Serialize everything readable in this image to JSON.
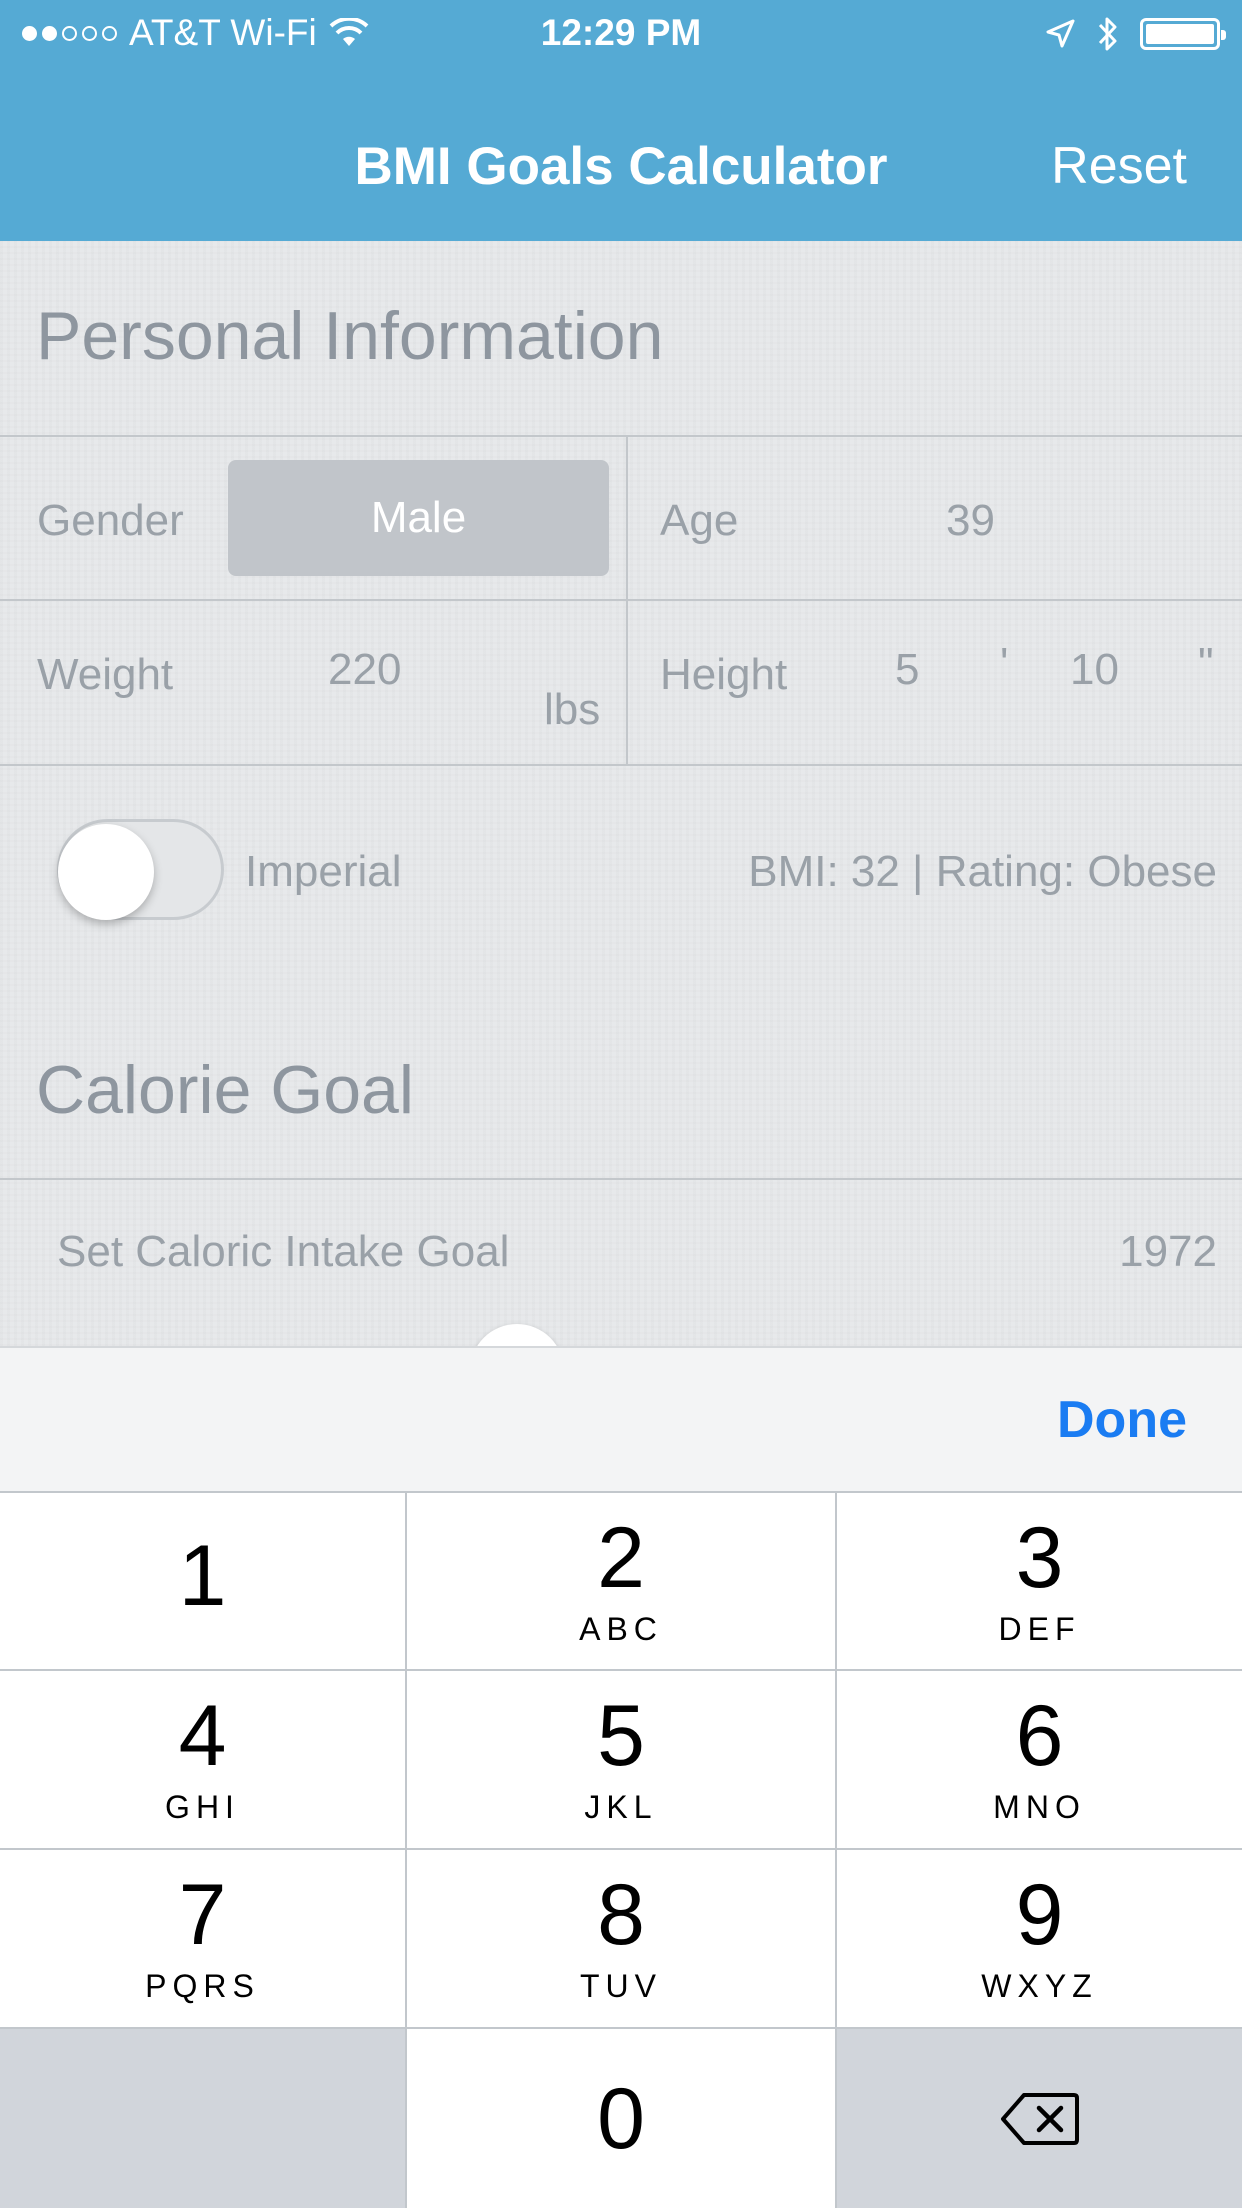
{
  "status_bar": {
    "carrier": "AT&T Wi-Fi",
    "time": "12:29 PM",
    "signal_dots": [
      true,
      true,
      false,
      false,
      false
    ]
  },
  "nav": {
    "title": "BMI Goals Calculator",
    "reset_label": "Reset"
  },
  "personal": {
    "title": "Personal Information",
    "gender_label": "Gender",
    "gender_value": "Male",
    "age_label": "Age",
    "age_value": "39",
    "weight_label": "Weight",
    "weight_value": "220",
    "weight_unit": "lbs",
    "height_label": "Height",
    "height_feet": "5",
    "feet_mark": "'",
    "height_inches": "10",
    "inch_mark": "\"",
    "units_toggle_label": "Imperial",
    "units_toggle_on": false,
    "bmi_summary": "BMI: 32 | Rating: Obese"
  },
  "calorie": {
    "title": "Calorie Goal",
    "intake_label": "Set Caloric Intake Goal",
    "intake_value": "1972"
  },
  "keyboard": {
    "done_label": "Done",
    "keys": [
      {
        "num": "1",
        "letters": ""
      },
      {
        "num": "2",
        "letters": "ABC"
      },
      {
        "num": "3",
        "letters": "DEF"
      },
      {
        "num": "4",
        "letters": "GHI"
      },
      {
        "num": "5",
        "letters": "JKL"
      },
      {
        "num": "6",
        "letters": "MNO"
      },
      {
        "num": "7",
        "letters": "PQRS"
      },
      {
        "num": "8",
        "letters": "TUV"
      },
      {
        "num": "9",
        "letters": "WXYZ"
      },
      {
        "num": "0",
        "letters": ""
      }
    ],
    "delete_icon": "backspace-icon"
  },
  "colors": {
    "nav_bar": "#55aad4",
    "done_blue": "#1a7cf2"
  }
}
